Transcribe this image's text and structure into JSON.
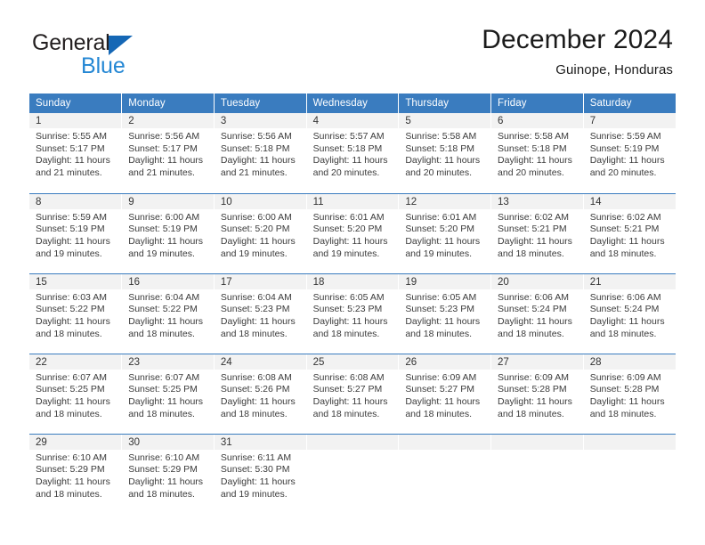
{
  "brand": {
    "name_part1": "General",
    "name_part2": "Blue",
    "triangle_color": "#1567b5",
    "blue_color": "#2487d4"
  },
  "header": {
    "title": "December 2024",
    "subtitle": "Guinope, Honduras"
  },
  "theme": {
    "header_blue": "#3a7cbf",
    "daynum_band": "#f2f2f2",
    "text": "#3b3b3b"
  },
  "weekdays": [
    "Sunday",
    "Monday",
    "Tuesday",
    "Wednesday",
    "Thursday",
    "Friday",
    "Saturday"
  ],
  "weeks": [
    [
      {
        "day": "1",
        "sunrise": "Sunrise: 5:55 AM",
        "sunset": "Sunset: 5:17 PM",
        "daylight": "Daylight: 11 hours and 21 minutes."
      },
      {
        "day": "2",
        "sunrise": "Sunrise: 5:56 AM",
        "sunset": "Sunset: 5:17 PM",
        "daylight": "Daylight: 11 hours and 21 minutes."
      },
      {
        "day": "3",
        "sunrise": "Sunrise: 5:56 AM",
        "sunset": "Sunset: 5:18 PM",
        "daylight": "Daylight: 11 hours and 21 minutes."
      },
      {
        "day": "4",
        "sunrise": "Sunrise: 5:57 AM",
        "sunset": "Sunset: 5:18 PM",
        "daylight": "Daylight: 11 hours and 20 minutes."
      },
      {
        "day": "5",
        "sunrise": "Sunrise: 5:58 AM",
        "sunset": "Sunset: 5:18 PM",
        "daylight": "Daylight: 11 hours and 20 minutes."
      },
      {
        "day": "6",
        "sunrise": "Sunrise: 5:58 AM",
        "sunset": "Sunset: 5:18 PM",
        "daylight": "Daylight: 11 hours and 20 minutes."
      },
      {
        "day": "7",
        "sunrise": "Sunrise: 5:59 AM",
        "sunset": "Sunset: 5:19 PM",
        "daylight": "Daylight: 11 hours and 20 minutes."
      }
    ],
    [
      {
        "day": "8",
        "sunrise": "Sunrise: 5:59 AM",
        "sunset": "Sunset: 5:19 PM",
        "daylight": "Daylight: 11 hours and 19 minutes."
      },
      {
        "day": "9",
        "sunrise": "Sunrise: 6:00 AM",
        "sunset": "Sunset: 5:19 PM",
        "daylight": "Daylight: 11 hours and 19 minutes."
      },
      {
        "day": "10",
        "sunrise": "Sunrise: 6:00 AM",
        "sunset": "Sunset: 5:20 PM",
        "daylight": "Daylight: 11 hours and 19 minutes."
      },
      {
        "day": "11",
        "sunrise": "Sunrise: 6:01 AM",
        "sunset": "Sunset: 5:20 PM",
        "daylight": "Daylight: 11 hours and 19 minutes."
      },
      {
        "day": "12",
        "sunrise": "Sunrise: 6:01 AM",
        "sunset": "Sunset: 5:20 PM",
        "daylight": "Daylight: 11 hours and 19 minutes."
      },
      {
        "day": "13",
        "sunrise": "Sunrise: 6:02 AM",
        "sunset": "Sunset: 5:21 PM",
        "daylight": "Daylight: 11 hours and 18 minutes."
      },
      {
        "day": "14",
        "sunrise": "Sunrise: 6:02 AM",
        "sunset": "Sunset: 5:21 PM",
        "daylight": "Daylight: 11 hours and 18 minutes."
      }
    ],
    [
      {
        "day": "15",
        "sunrise": "Sunrise: 6:03 AM",
        "sunset": "Sunset: 5:22 PM",
        "daylight": "Daylight: 11 hours and 18 minutes."
      },
      {
        "day": "16",
        "sunrise": "Sunrise: 6:04 AM",
        "sunset": "Sunset: 5:22 PM",
        "daylight": "Daylight: 11 hours and 18 minutes."
      },
      {
        "day": "17",
        "sunrise": "Sunrise: 6:04 AM",
        "sunset": "Sunset: 5:23 PM",
        "daylight": "Daylight: 11 hours and 18 minutes."
      },
      {
        "day": "18",
        "sunrise": "Sunrise: 6:05 AM",
        "sunset": "Sunset: 5:23 PM",
        "daylight": "Daylight: 11 hours and 18 minutes."
      },
      {
        "day": "19",
        "sunrise": "Sunrise: 6:05 AM",
        "sunset": "Sunset: 5:23 PM",
        "daylight": "Daylight: 11 hours and 18 minutes."
      },
      {
        "day": "20",
        "sunrise": "Sunrise: 6:06 AM",
        "sunset": "Sunset: 5:24 PM",
        "daylight": "Daylight: 11 hours and 18 minutes."
      },
      {
        "day": "21",
        "sunrise": "Sunrise: 6:06 AM",
        "sunset": "Sunset: 5:24 PM",
        "daylight": "Daylight: 11 hours and 18 minutes."
      }
    ],
    [
      {
        "day": "22",
        "sunrise": "Sunrise: 6:07 AM",
        "sunset": "Sunset: 5:25 PM",
        "daylight": "Daylight: 11 hours and 18 minutes."
      },
      {
        "day": "23",
        "sunrise": "Sunrise: 6:07 AM",
        "sunset": "Sunset: 5:25 PM",
        "daylight": "Daylight: 11 hours and 18 minutes."
      },
      {
        "day": "24",
        "sunrise": "Sunrise: 6:08 AM",
        "sunset": "Sunset: 5:26 PM",
        "daylight": "Daylight: 11 hours and 18 minutes."
      },
      {
        "day": "25",
        "sunrise": "Sunrise: 6:08 AM",
        "sunset": "Sunset: 5:27 PM",
        "daylight": "Daylight: 11 hours and 18 minutes."
      },
      {
        "day": "26",
        "sunrise": "Sunrise: 6:09 AM",
        "sunset": "Sunset: 5:27 PM",
        "daylight": "Daylight: 11 hours and 18 minutes."
      },
      {
        "day": "27",
        "sunrise": "Sunrise: 6:09 AM",
        "sunset": "Sunset: 5:28 PM",
        "daylight": "Daylight: 11 hours and 18 minutes."
      },
      {
        "day": "28",
        "sunrise": "Sunrise: 6:09 AM",
        "sunset": "Sunset: 5:28 PM",
        "daylight": "Daylight: 11 hours and 18 minutes."
      }
    ],
    [
      {
        "day": "29",
        "sunrise": "Sunrise: 6:10 AM",
        "sunset": "Sunset: 5:29 PM",
        "daylight": "Daylight: 11 hours and 18 minutes."
      },
      {
        "day": "30",
        "sunrise": "Sunrise: 6:10 AM",
        "sunset": "Sunset: 5:29 PM",
        "daylight": "Daylight: 11 hours and 18 minutes."
      },
      {
        "day": "31",
        "sunrise": "Sunrise: 6:11 AM",
        "sunset": "Sunset: 5:30 PM",
        "daylight": "Daylight: 11 hours and 19 minutes."
      },
      {
        "day": "",
        "sunrise": "",
        "sunset": "",
        "daylight": ""
      },
      {
        "day": "",
        "sunrise": "",
        "sunset": "",
        "daylight": ""
      },
      {
        "day": "",
        "sunrise": "",
        "sunset": "",
        "daylight": ""
      },
      {
        "day": "",
        "sunrise": "",
        "sunset": "",
        "daylight": ""
      }
    ]
  ]
}
